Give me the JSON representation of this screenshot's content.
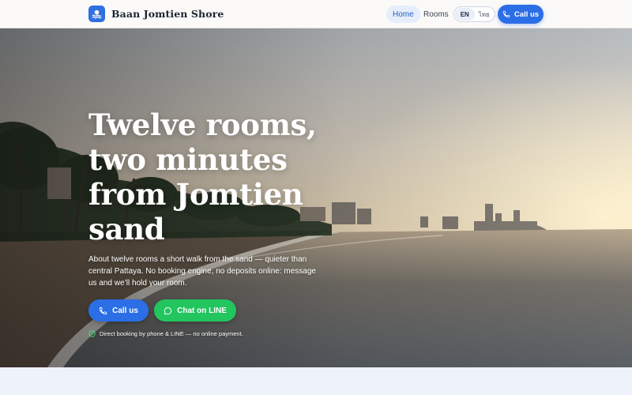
{
  "brand": {
    "name": "Baan Jomtien Shore",
    "logo_icon": "beach-waves-icon"
  },
  "nav": {
    "home_label": "Home",
    "rooms_label": "Rooms",
    "lang_en": "EN",
    "lang_th": "ไทย",
    "active_lang": "EN",
    "call_label": "Call us",
    "call_icon": "phone-icon"
  },
  "hero": {
    "title": "Twelve rooms, two minutes from Jomtien sand",
    "lead": "About twelve rooms a short walk from the sand — quieter than central Pattaya. No booking engine, no deposits online: message us and we’ll hold your room.",
    "call_label": "Call us",
    "line_label": "Chat on LINE",
    "line_icon": "chat-bubble-icon",
    "note": "Direct booking by phone & LINE — no online payment.",
    "note_icon": "check-circle-icon"
  },
  "colors": {
    "accent": "#2b6ee6",
    "line_green": "#22c55e"
  }
}
